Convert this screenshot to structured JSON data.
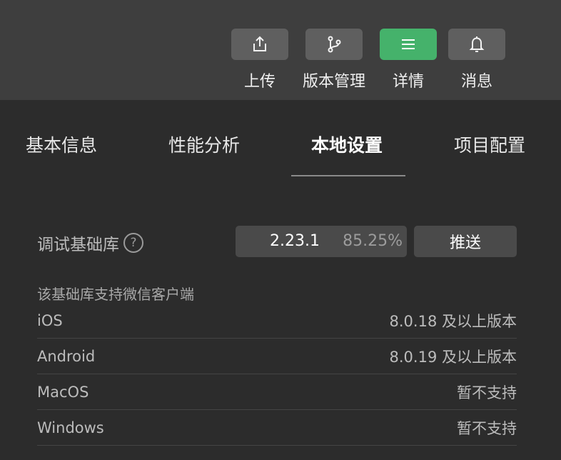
{
  "toolbar": {
    "items": [
      {
        "label": "上传",
        "icon": "upload-icon"
      },
      {
        "label": "版本管理",
        "icon": "branch-icon"
      },
      {
        "label": "详情",
        "icon": "menu-icon",
        "active": true
      },
      {
        "label": "消息",
        "icon": "bell-icon"
      }
    ],
    "active_color": "#45b26b"
  },
  "tabs": [
    {
      "label": "基本信息"
    },
    {
      "label": "性能分析"
    },
    {
      "label": "本地设置",
      "active": true
    },
    {
      "label": "项目配置"
    }
  ],
  "debug_lib": {
    "label": "调试基础库",
    "help": "?",
    "version": "2.23.1",
    "percent": "85.25%",
    "push_label": "推送"
  },
  "support": {
    "title": "该基础库支持微信客户端",
    "platforms": [
      {
        "name": "iOS",
        "value": "8.0.18 及以上版本"
      },
      {
        "name": "Android",
        "value": "8.0.19 及以上版本"
      },
      {
        "name": "MacOS",
        "value": "暂不支持"
      },
      {
        "name": "Windows",
        "value": "暂不支持"
      }
    ]
  }
}
